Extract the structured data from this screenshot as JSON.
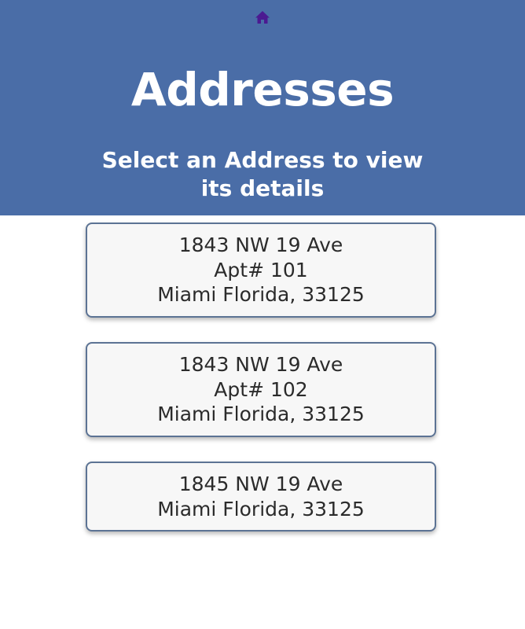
{
  "nav": {
    "home_icon": "home-icon",
    "icon_color": "#4b1a91"
  },
  "header": {
    "title": "Addresses",
    "subtitle": "Select an Address to view its details",
    "background": "#4a6da7"
  },
  "addresses": [
    {
      "street": "1843 NW 19 Ave",
      "unit": "Apt# 101",
      "city": "Miami Florida, 33125"
    },
    {
      "street": "1843 NW 19 Ave",
      "unit": "Apt# 102",
      "city": "Miami Florida, 33125"
    },
    {
      "street": "1845 NW 19 Ave",
      "city": "Miami Florida, 33125"
    }
  ]
}
